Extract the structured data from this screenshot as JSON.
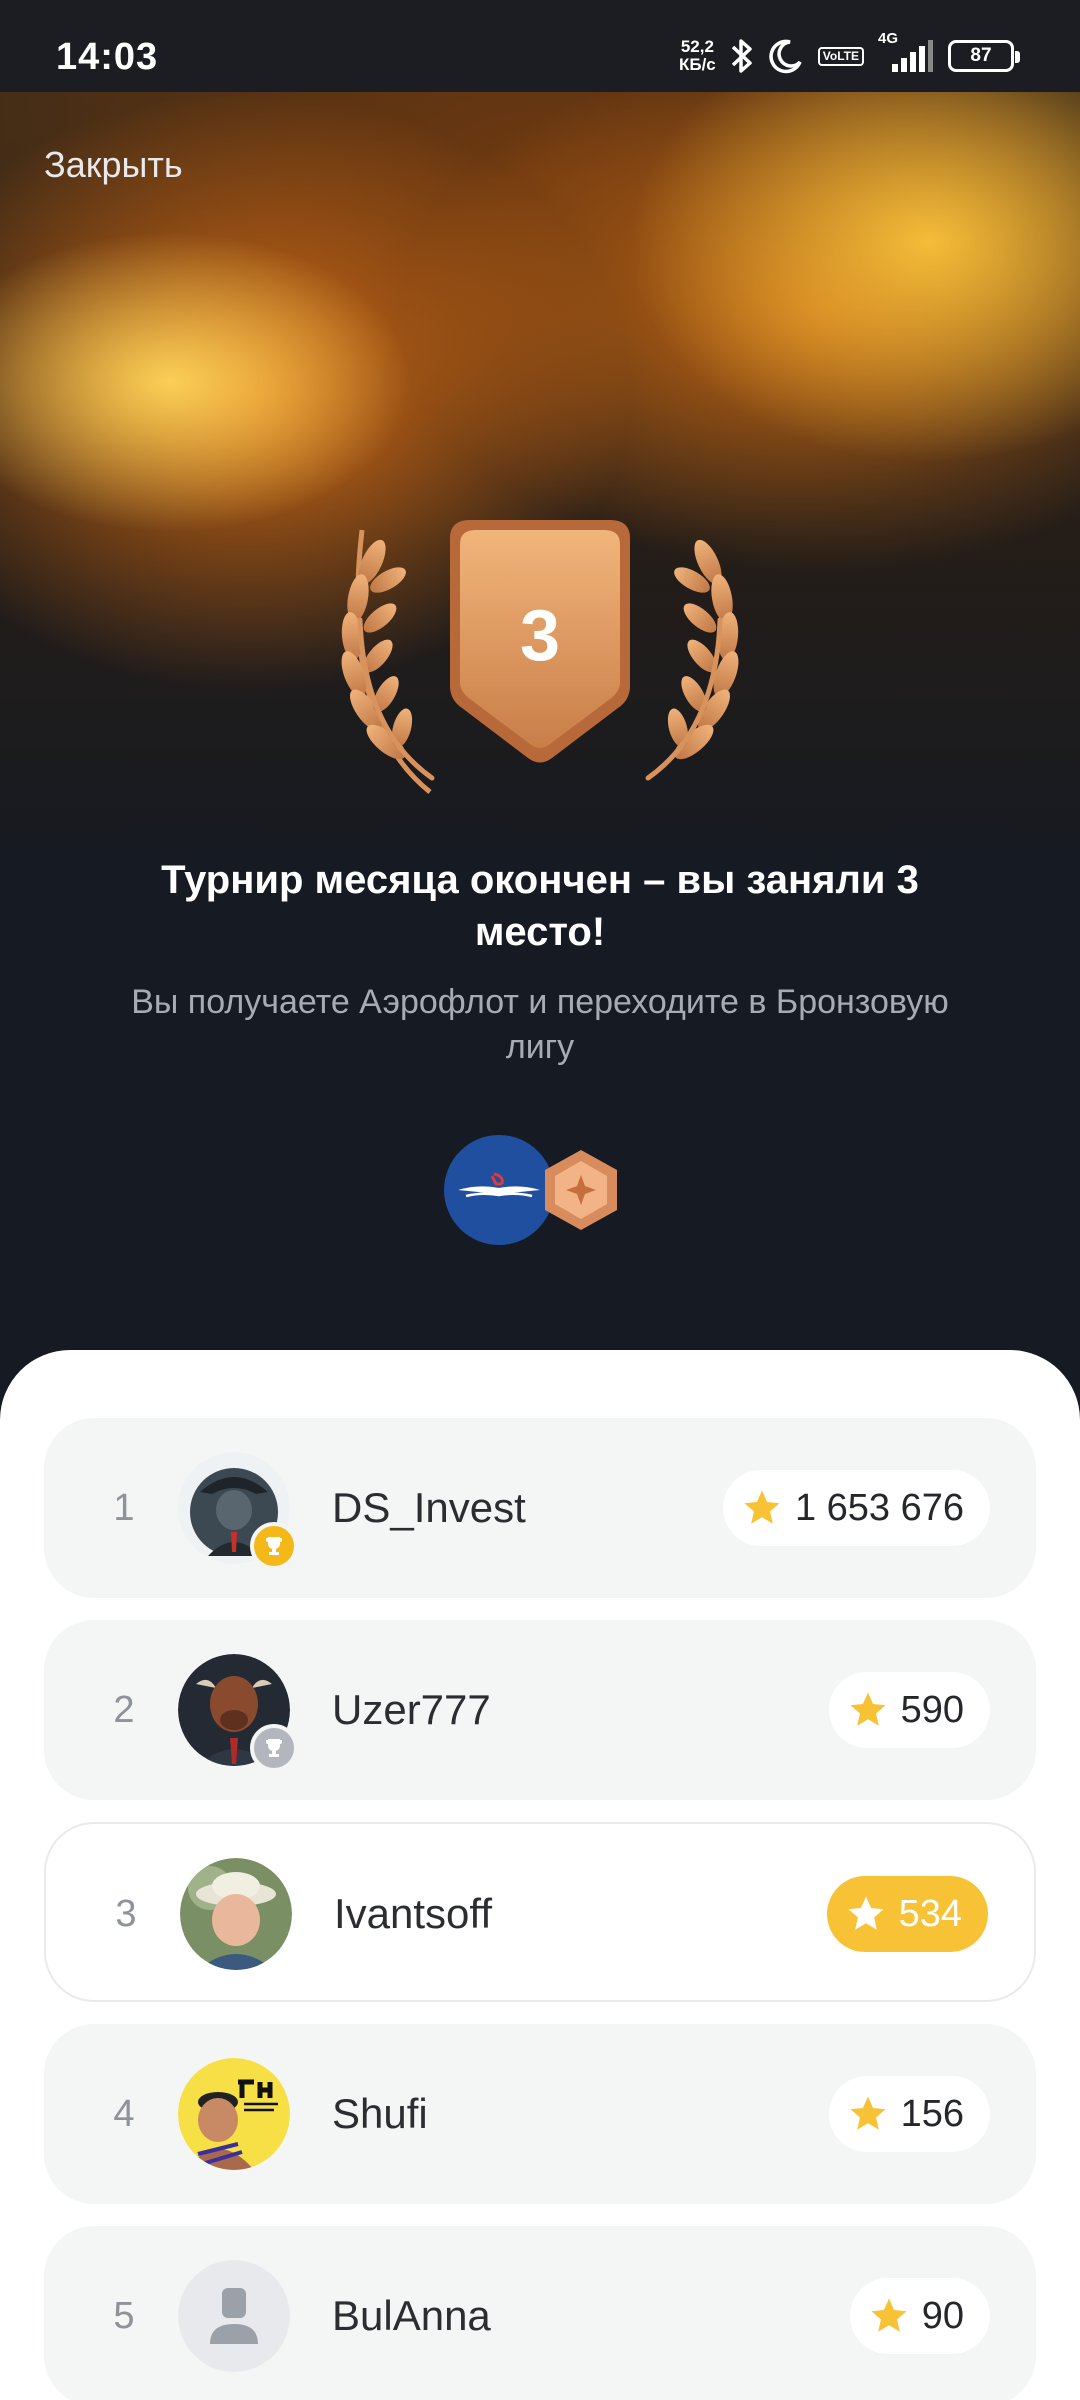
{
  "status_bar": {
    "time": "14:03",
    "net_speed_value": "52,2",
    "net_speed_unit": "КБ/с",
    "volte_top": "Vo",
    "volte_bottom": "LTE",
    "network": "4G",
    "battery": "87",
    "icons": [
      "bluetooth-icon",
      "moon-icon",
      "volte-icon",
      "signal-icon",
      "battery-icon"
    ]
  },
  "hero": {
    "close_label": "Закрыть",
    "place": "3",
    "title": "Турнир месяца окончен – вы заняли 3 место!",
    "subtitle": "Вы получаете Аэрофлот и переходите в Бронзовую лигу",
    "rewards": [
      "aeroflot-logo",
      "bronze-league-badge"
    ]
  },
  "leaderboard": {
    "rows": [
      {
        "rank": "1",
        "name": "DS_Invest",
        "score": "1 653 676",
        "trophy": "gold",
        "current": false
      },
      {
        "rank": "2",
        "name": "Uzer777",
        "score": "590",
        "trophy": "silver",
        "current": false
      },
      {
        "rank": "3",
        "name": "Ivantsoff",
        "score": "534",
        "trophy": "",
        "current": true
      },
      {
        "rank": "4",
        "name": "Shufi",
        "score": "156",
        "trophy": "",
        "current": false
      },
      {
        "rank": "5",
        "name": "BulAnna",
        "score": "90",
        "trophy": "",
        "current": false
      }
    ],
    "colors": {
      "gold": "#f4b818",
      "silver": "#b3b7bd",
      "star": "#f8c236",
      "highlight": "#f8c236"
    }
  }
}
